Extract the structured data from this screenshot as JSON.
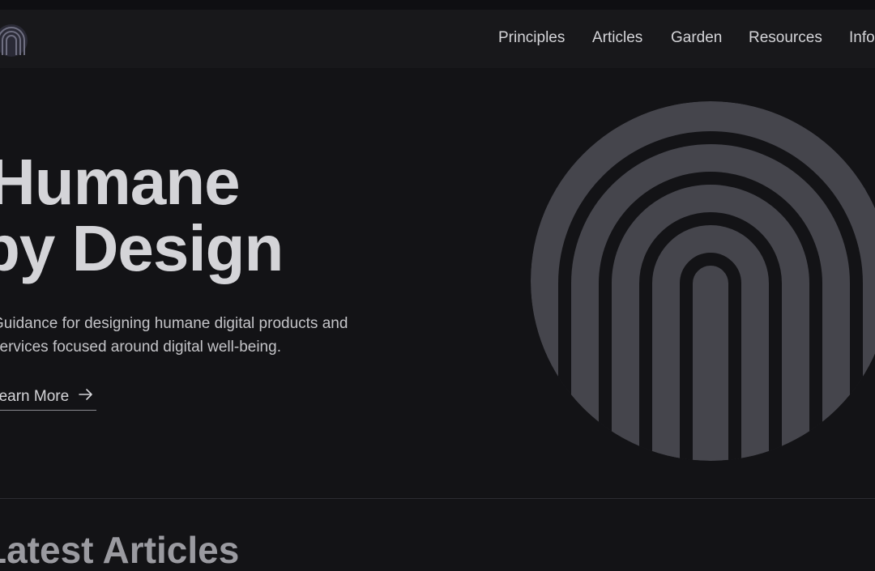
{
  "nav": {
    "items": [
      {
        "label": "Principles"
      },
      {
        "label": "Articles"
      },
      {
        "label": "Garden"
      },
      {
        "label": "Resources"
      },
      {
        "label": "Info"
      }
    ]
  },
  "hero": {
    "title_line1": "Humane",
    "title_line2": "by Design",
    "description": "Guidance for designing humane digital products and services focused around digital well-being.",
    "cta_label": "Learn More"
  },
  "section": {
    "heading": "Latest Articles"
  },
  "icons": {
    "logo": "fingerprint-arch-logo",
    "cta_arrow": "arrow-right-icon",
    "hero_graphic": "fingerprint-arch-emblem"
  },
  "colors": {
    "background": "#131316",
    "navbar": "#18181b",
    "text": "#d4d4d8",
    "emblem": "#45454c"
  }
}
